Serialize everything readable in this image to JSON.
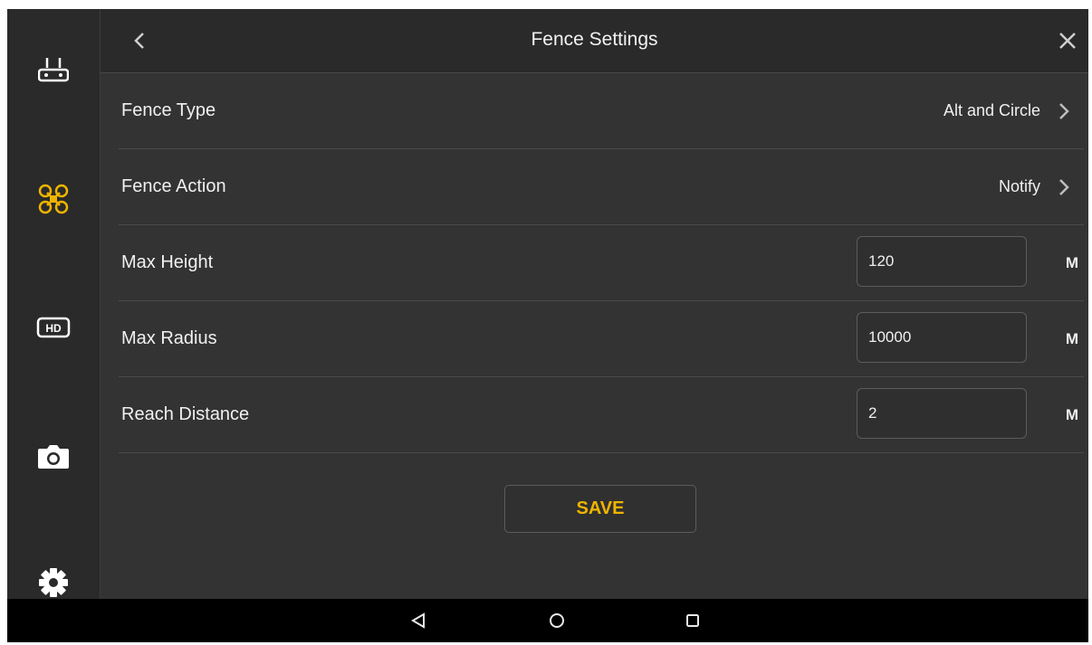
{
  "header": {
    "title": "Fence Settings"
  },
  "sidebar": {
    "items": [
      {
        "icon": "remote-controller-icon"
      },
      {
        "icon": "drone-icon",
        "active": true
      },
      {
        "icon": "hd-icon"
      },
      {
        "icon": "camera-icon"
      },
      {
        "icon": "gear-icon"
      }
    ],
    "active_color": "#f0b400"
  },
  "settings": {
    "fence_type": {
      "label": "Fence Type",
      "value": "Alt and Circle"
    },
    "fence_action": {
      "label": "Fence Action",
      "value": "Notify"
    },
    "max_height": {
      "label": "Max Height",
      "value": "120",
      "unit": "M"
    },
    "max_radius": {
      "label": "Max Radius",
      "value": "10000",
      "unit": "M"
    },
    "reach_distance": {
      "label": "Reach Distance",
      "value": "2",
      "unit": "M"
    }
  },
  "save_label": "SAVE",
  "navbar": {
    "icons": [
      "nav-back-icon",
      "nav-home-icon",
      "nav-recents-icon"
    ]
  }
}
